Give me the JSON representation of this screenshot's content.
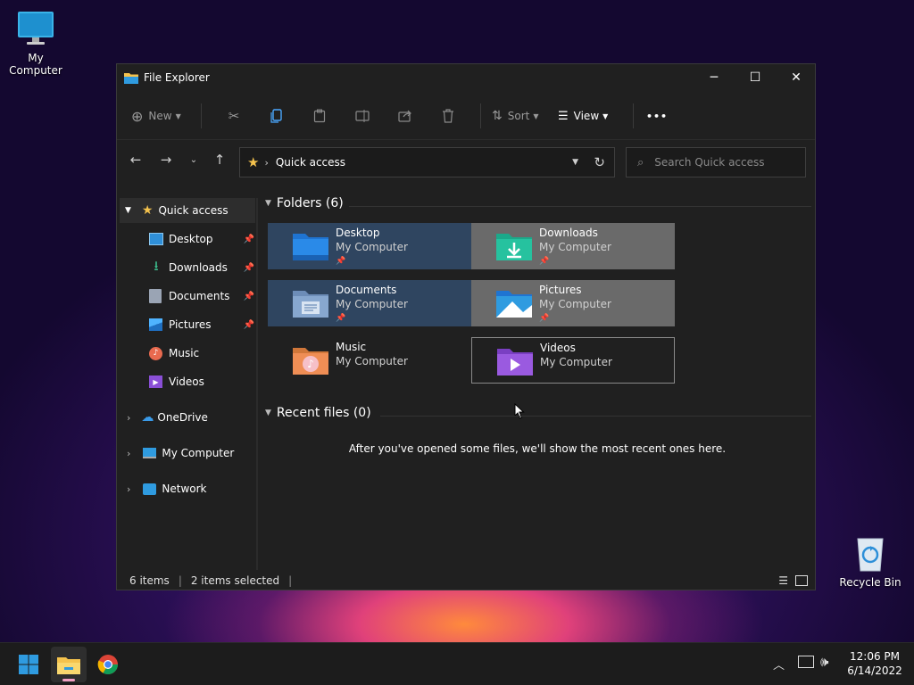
{
  "desktop": {
    "icons": [
      {
        "label": "My Computer"
      },
      {
        "label": "Recycle Bin"
      }
    ]
  },
  "window": {
    "title": "File Explorer",
    "controls": {
      "minimize": "─",
      "maximize": "☐",
      "close": "✕"
    }
  },
  "toolbar": {
    "new_label": "New",
    "sort_label": "Sort",
    "view_label": "View",
    "more_label": "•••"
  },
  "address": {
    "path": "Quick access",
    "search_placeholder": "Search Quick access"
  },
  "sidebar": {
    "items": [
      {
        "label": "Quick access",
        "icon": "star-icon",
        "selected": true
      },
      {
        "label": "Desktop",
        "icon": "desktop-icon",
        "pinned": true
      },
      {
        "label": "Downloads",
        "icon": "downloads-icon",
        "pinned": true
      },
      {
        "label": "Documents",
        "icon": "documents-icon",
        "pinned": true
      },
      {
        "label": "Pictures",
        "icon": "pictures-icon",
        "pinned": true
      },
      {
        "label": "Music",
        "icon": "music-icon"
      },
      {
        "label": "Videos",
        "icon": "videos-icon"
      },
      {
        "label": "OneDrive",
        "icon": "onedrive-icon"
      },
      {
        "label": "My Computer",
        "icon": "computer-icon"
      },
      {
        "label": "Network",
        "icon": "network-icon"
      }
    ]
  },
  "content": {
    "folders_header": "Folders (6)",
    "recent_header": "Recent files (0)",
    "recent_empty": "After you've opened some files, we'll show the most recent ones here.",
    "folders": [
      {
        "name": "Desktop",
        "location": "My Computer",
        "state": "selected"
      },
      {
        "name": "Downloads",
        "location": "My Computer",
        "state": "gray"
      },
      {
        "name": "Documents",
        "location": "My Computer",
        "state": "selected"
      },
      {
        "name": "Pictures",
        "location": "My Computer",
        "state": "gray"
      },
      {
        "name": "Music",
        "location": "My Computer",
        "state": "normal"
      },
      {
        "name": "Videos",
        "location": "My Computer",
        "state": "hover"
      }
    ]
  },
  "status": {
    "items": "6 items",
    "selected": "2 items selected"
  },
  "taskbar": {
    "time": "12:06 PM",
    "date": "6/14/2022"
  },
  "colors": {
    "accent": "#0078d4",
    "folder_yellow": "#f4c24d"
  }
}
